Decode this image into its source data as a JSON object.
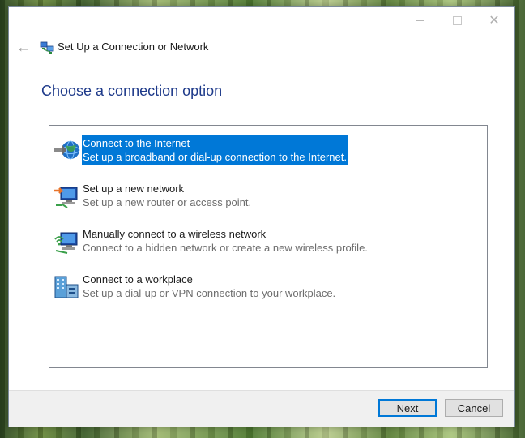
{
  "window": {
    "title": "Set Up a Connection or Network",
    "caption_buttons": {
      "minimize_icon": "minimize-icon",
      "maximize_icon": "maximize-icon",
      "close_icon": "close-icon",
      "close_glyph": "✕"
    },
    "back_glyph": "←"
  },
  "heading": "Choose a connection option",
  "options": [
    {
      "title": "Connect to the Internet",
      "description": "Set up a broadband or dial-up connection to the Internet.",
      "icon": "globe-network-icon",
      "selected": true
    },
    {
      "title": "Set up a new network",
      "description": "Set up a new router or access point.",
      "icon": "new-network-icon",
      "selected": false
    },
    {
      "title": "Manually connect to a wireless network",
      "description": "Connect to a hidden network or create a new wireless profile.",
      "icon": "wireless-network-icon",
      "selected": false
    },
    {
      "title": "Connect to a workplace",
      "description": "Set up a dial-up or VPN connection to your workplace.",
      "icon": "workplace-icon",
      "selected": false
    }
  ],
  "footer": {
    "next_label": "Next",
    "cancel_label": "Cancel"
  },
  "colors": {
    "selection": "#0078d7",
    "heading": "#1e3a8a"
  }
}
